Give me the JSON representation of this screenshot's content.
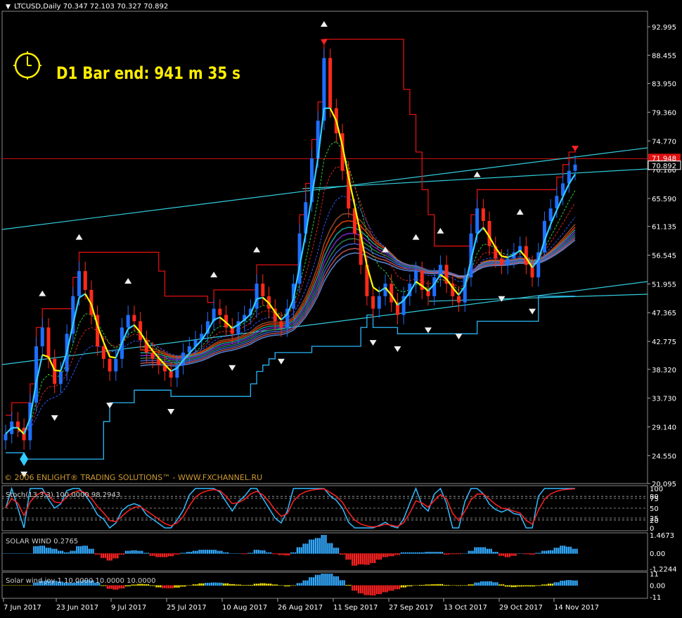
{
  "header": {
    "symbol_line": "LTCUSD,Daily  70.347 72.103 70.327 70.892"
  },
  "timer": {
    "label": "D1 Bar end: 941 m 35 s"
  },
  "copyright": "© 2006 ENLIGHT® TRADING SOLUTIONS™ - WWW.FXCHANNEL.RU",
  "colors": {
    "background": "#000000",
    "bull_candle": "#1e6fff",
    "bear_candle": "#ff2a1a",
    "channel_upper": "#e01010",
    "channel_lower": "#29b6f6",
    "trendline": "#33ccdd",
    "timer_text": "#ffee00",
    "last_price_box": "#e01010"
  },
  "chart_data": [
    {
      "name_id": "price",
      "type": "candlestick",
      "y_ticks": [
        "92.995",
        "88.455",
        "83.950",
        "79.360",
        "74.770",
        "70.180",
        "65.590",
        "61.135",
        "56.545",
        "51.955",
        "47.365",
        "42.775",
        "38.320",
        "33.730",
        "29.140",
        "24.550",
        "20.095"
      ],
      "ylim": [
        20.095,
        95.0
      ],
      "price_labels": {
        "current": "70.892",
        "red_line": "71.948"
      },
      "x_ticks": [
        "7 Jun 2017",
        "23 Jun 2017",
        "9 Jul 2017",
        "25 Jul 2017",
        "10 Aug 2017",
        "26 Aug 2017",
        "11 Sep 2017",
        "27 Sep 2017",
        "13 Oct 2017",
        "29 Oct 2017",
        "14 Nov 2017"
      ],
      "closes": [
        28,
        30,
        29,
        27,
        33,
        42,
        45,
        40,
        36,
        38,
        44,
        50,
        54,
        51,
        47,
        42,
        40,
        38,
        40,
        45,
        47,
        46,
        43,
        41,
        40,
        39,
        38,
        37,
        39,
        41,
        42,
        43,
        44,
        46,
        48,
        47,
        45,
        44,
        46,
        47,
        48,
        52,
        50,
        48,
        46,
        45,
        48,
        52,
        60,
        65,
        72,
        78,
        88,
        80,
        76,
        70,
        64,
        60,
        55,
        50,
        48,
        50,
        52,
        49,
        47,
        50,
        52,
        54,
        51,
        50,
        53,
        55,
        52,
        50,
        49,
        53,
        60,
        64,
        62,
        58,
        56,
        55,
        56,
        57,
        58,
        55,
        53,
        57,
        62,
        64,
        66,
        68,
        70,
        71
      ]
    },
    {
      "name_id": "stochastic",
      "type": "line",
      "label": "Stoch(13,3,3) 100.0000 98.2943",
      "y_ticks": [
        "100",
        "80",
        "75",
        "50",
        "25",
        "20",
        "0"
      ],
      "ylim": [
        0,
        100
      ]
    },
    {
      "name_id": "solar_wind",
      "type": "histogram",
      "label": "SOLAR WIND 0.2765",
      "y_ticks": [
        "1.4673",
        "0.00",
        "-1.2244"
      ],
      "ylim": [
        -1.2244,
        1.4673
      ]
    },
    {
      "name_id": "solar_wind_joy",
      "type": "histogram",
      "label": "Solar wind joy 1 10.0000 10.0000 10.0000",
      "y_ticks": [
        "11",
        "0.00",
        "-11"
      ],
      "ylim": [
        -11,
        11
      ]
    }
  ]
}
